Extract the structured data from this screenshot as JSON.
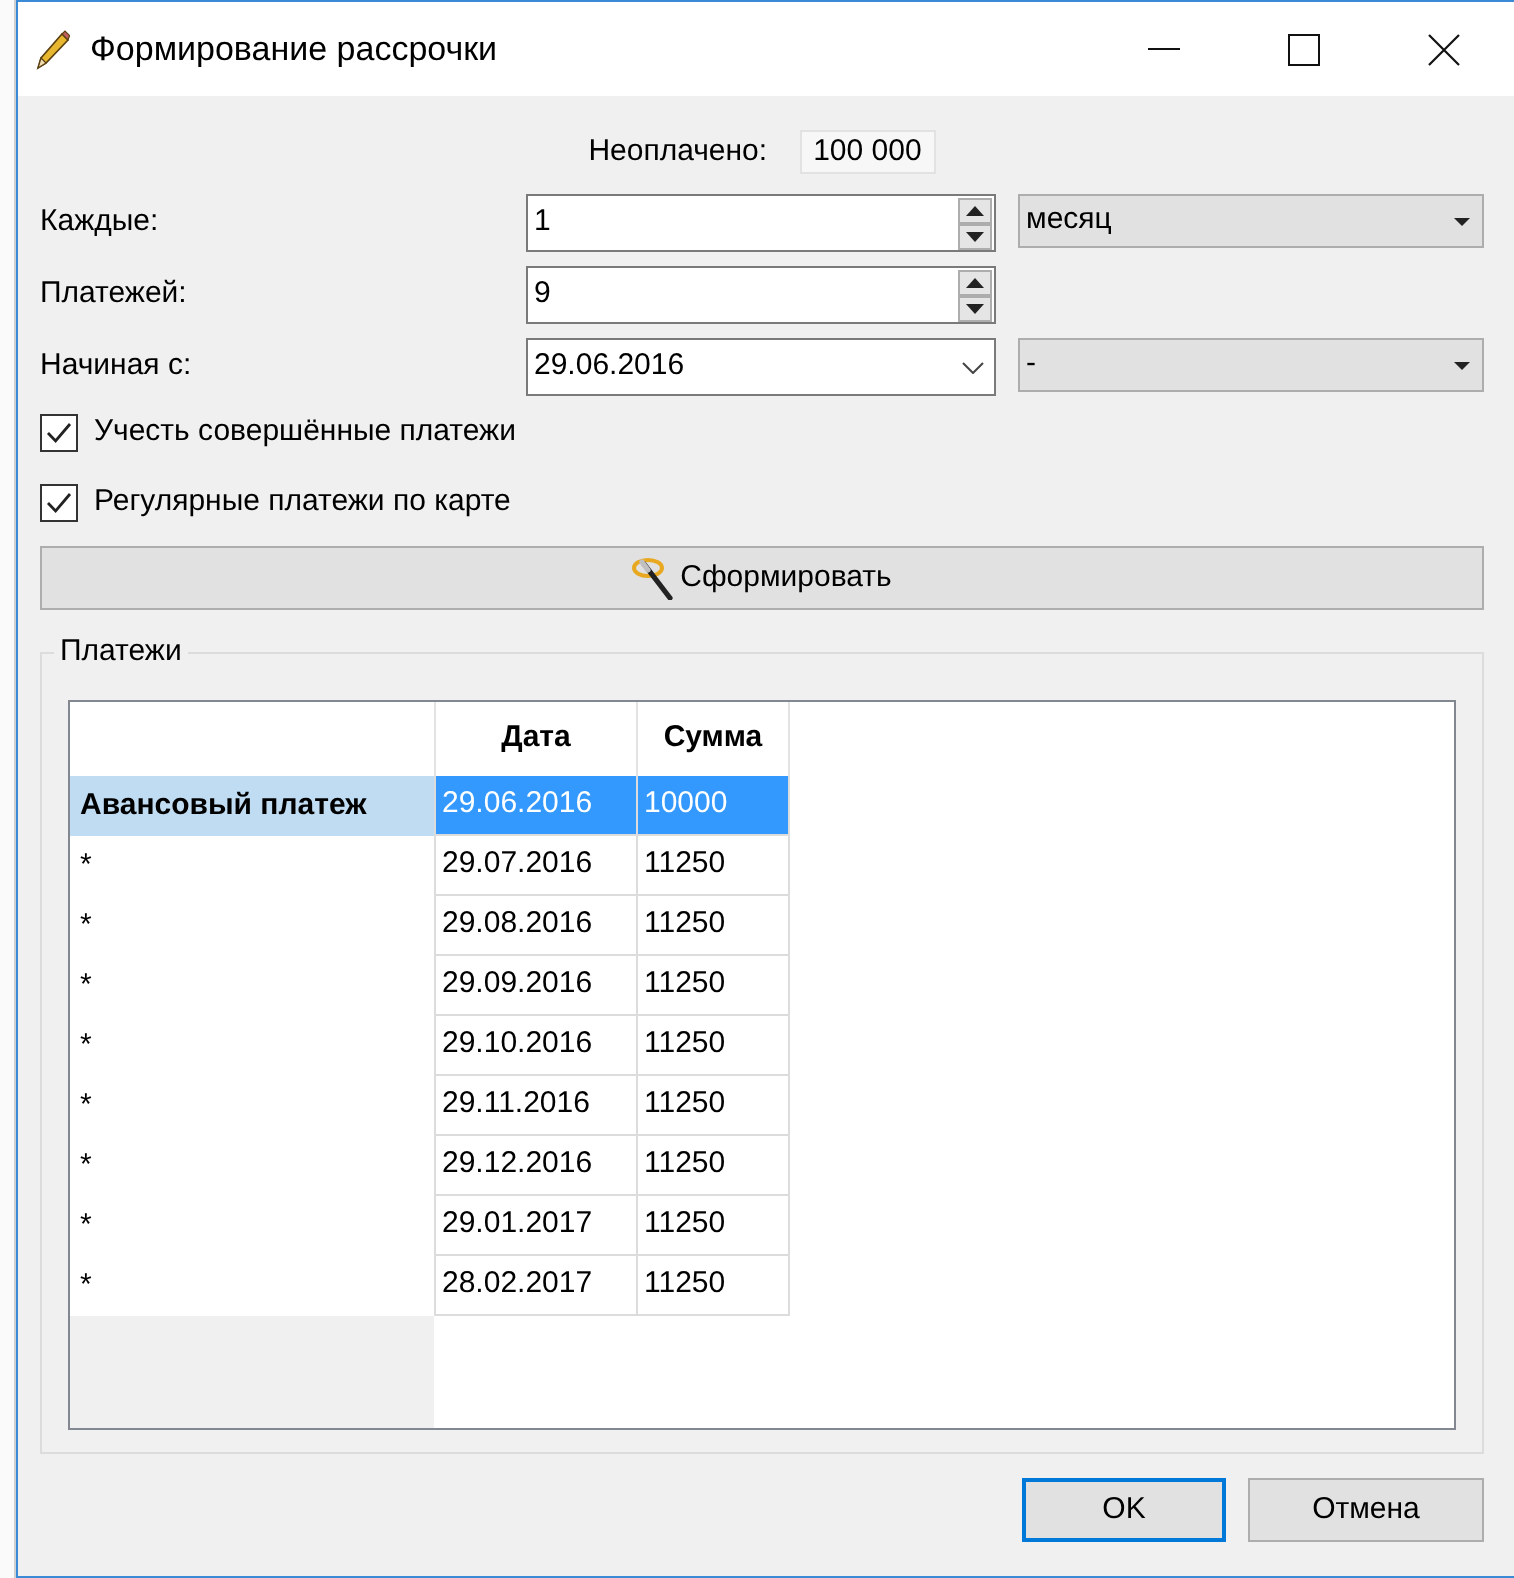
{
  "window": {
    "title": "Формирование рассрочки"
  },
  "unpaid": {
    "label": "Неоплачено:",
    "value": "100 000"
  },
  "fields": [
    {
      "kind": "spin",
      "label": "Каждые:",
      "value": "1",
      "unit": {
        "value": "месяц"
      }
    },
    {
      "kind": "spin",
      "label": "Платежей:",
      "value": "9"
    },
    {
      "kind": "date",
      "label": "Начиная с:",
      "value": "29.06.2016",
      "unit": {
        "value": "-"
      }
    }
  ],
  "checkboxes": [
    {
      "label": "Учесть совершённые платежи",
      "checked": true
    },
    {
      "label": "Регулярные платежи по карте",
      "checked": true
    }
  ],
  "generate_button": {
    "label": "Сформировать"
  },
  "payments": {
    "title": "Платежи",
    "columns": [
      "Дата",
      "Сумма"
    ],
    "rows": [
      {
        "header": "Авансовый платеж",
        "date": "29.06.2016",
        "amount": "10000",
        "selected": true
      },
      {
        "header": "*",
        "date": "29.07.2016",
        "amount": "11250",
        "selected": false
      },
      {
        "header": "*",
        "date": "29.08.2016",
        "amount": "11250",
        "selected": false
      },
      {
        "header": "*",
        "date": "29.09.2016",
        "amount": "11250",
        "selected": false
      },
      {
        "header": "*",
        "date": "29.10.2016",
        "amount": "11250",
        "selected": false
      },
      {
        "header": "*",
        "date": "29.11.2016",
        "amount": "11250",
        "selected": false
      },
      {
        "header": "*",
        "date": "29.12.2016",
        "amount": "11250",
        "selected": false
      },
      {
        "header": "*",
        "date": "29.01.2017",
        "amount": "11250",
        "selected": false
      },
      {
        "header": "*",
        "date": "28.02.2017",
        "amount": "11250",
        "selected": false
      }
    ]
  },
  "buttons": [
    {
      "label": "OK",
      "default": true
    },
    {
      "label": "Отмена",
      "default": false
    }
  ]
}
